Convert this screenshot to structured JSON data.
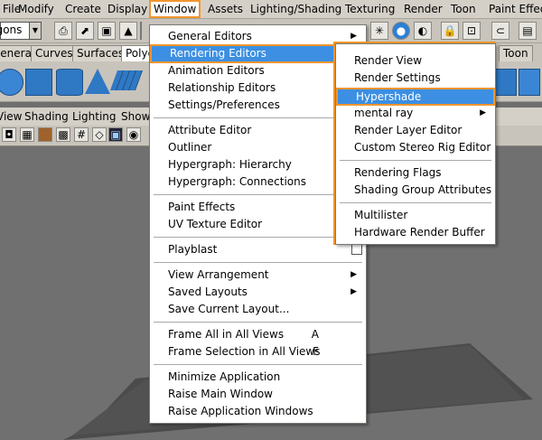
{
  "menubar": {
    "items": [
      {
        "label": "File"
      },
      {
        "label": "Modify"
      },
      {
        "label": "Create"
      },
      {
        "label": "Display"
      },
      {
        "label": "Window"
      },
      {
        "label": "Assets"
      },
      {
        "label": "Lighting/Shading"
      },
      {
        "label": "Texturing"
      },
      {
        "label": "Render"
      },
      {
        "label": "Toon"
      },
      {
        "label": "Paint Effects"
      }
    ]
  },
  "shelf_tabs": [
    "General",
    "Curves",
    "Surfaces",
    "Polygons",
    "Toon"
  ],
  "panel_menu": [
    "View",
    "Shading",
    "Lighting",
    "Show"
  ],
  "window_menu": {
    "items": [
      {
        "label": "General Editors",
        "submenu": true
      },
      {
        "label": "Rendering Editors",
        "submenu": true
      },
      {
        "label": "Animation Editors",
        "submenu": true
      },
      {
        "label": "Relationship Editors",
        "submenu": true
      },
      {
        "label": "Settings/Preferences",
        "submenu": true
      },
      {
        "label": "Attribute Editor"
      },
      {
        "label": "Outliner"
      },
      {
        "label": "Hypergraph: Hierarchy"
      },
      {
        "label": "Hypergraph: Connections"
      },
      {
        "label": "Paint Effects"
      },
      {
        "label": "UV Texture Editor"
      },
      {
        "label": "Playblast",
        "option": true
      },
      {
        "label": "View Arrangement",
        "submenu": true
      },
      {
        "label": "Saved Layouts",
        "submenu": true
      },
      {
        "label": "Save Current Layout..."
      },
      {
        "label": "Frame All in All Views",
        "shortcut": "A"
      },
      {
        "label": "Frame Selection in All Views",
        "shortcut": "F"
      },
      {
        "label": "Minimize Application"
      },
      {
        "label": "Raise Main Window"
      },
      {
        "label": "Raise Application Windows"
      }
    ]
  },
  "rendering_editors_menu": {
    "items": [
      {
        "label": "Render View"
      },
      {
        "label": "Render Settings"
      },
      {
        "label": "Hypershade"
      },
      {
        "label": "mental ray",
        "submenu": true
      },
      {
        "label": "Render Layer Editor"
      },
      {
        "label": "Custom Stereo Rig Editor"
      },
      {
        "label": "Rendering Flags"
      },
      {
        "label": "Shading Group Attributes"
      },
      {
        "label": "Multilister"
      },
      {
        "label": "Hardware Render Buffer"
      }
    ]
  },
  "status": {
    "mode_dropdown": "Polygons"
  },
  "colors": {
    "highlight": "#3c8fe2",
    "callout": "#f0962d",
    "menu_bg": "#ffffff",
    "toolbar": "#c8c4bc"
  }
}
